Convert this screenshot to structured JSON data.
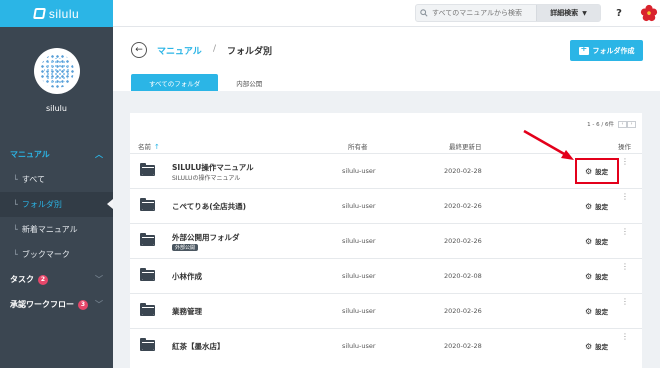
{
  "app": {
    "name": "silulu"
  },
  "user": {
    "name": "silulu"
  },
  "sidebar": {
    "items": [
      {
        "label": "マニュアル",
        "type": "header"
      },
      {
        "label": "すべて",
        "type": "sub"
      },
      {
        "label": "フォルダ別",
        "type": "sub-active"
      },
      {
        "label": "新着マニュアル",
        "type": "sub"
      },
      {
        "label": "ブックマーク",
        "type": "sub"
      },
      {
        "label": "タスク",
        "type": "section",
        "badge": "2"
      },
      {
        "label": "承認ワークフロー",
        "type": "section",
        "badge": "3"
      }
    ],
    "tick": "└"
  },
  "topbar": {
    "search_placeholder": "すべてのマニュアルから検索",
    "advanced_search": "詳細検索",
    "help": "?"
  },
  "header": {
    "breadcrumb_link": "マニュアル",
    "breadcrumb_sep": "/",
    "breadcrumb_current": "フォルダ別",
    "create_button": "フォルダ作成",
    "tabs": [
      "すべてのフォルダ",
      "内部公開"
    ]
  },
  "table": {
    "pager": "1 - 6 / 6件",
    "headers": {
      "name": "名前",
      "owner": "所有者",
      "updated": "最終更新日",
      "actions": "操作"
    },
    "settings_label": "設定",
    "rows": [
      {
        "name": "SILULU操作マニュアル",
        "desc": "SILULUの操作マニュアル",
        "owner": "silulu-user",
        "date": "2020-02-28"
      },
      {
        "name": "こぺてりあ(全店共通)",
        "owner": "silulu-user",
        "date": "2020-02-26"
      },
      {
        "name": "外部公開用フォルダ",
        "tag": "外部公開",
        "owner": "silulu-user",
        "date": "2020-02-26"
      },
      {
        "name": "小林作成",
        "owner": "silulu-user",
        "date": "2020-02-08"
      },
      {
        "name": "業務管理",
        "owner": "silulu-user",
        "date": "2020-02-26"
      },
      {
        "name": "紅茶【墨水店】",
        "owner": "silulu-user",
        "date": "2020-02-28"
      }
    ]
  },
  "colors": {
    "accent": "#2bb5e6",
    "sidebar": "#3b4651",
    "annotation": "#e3001b"
  }
}
